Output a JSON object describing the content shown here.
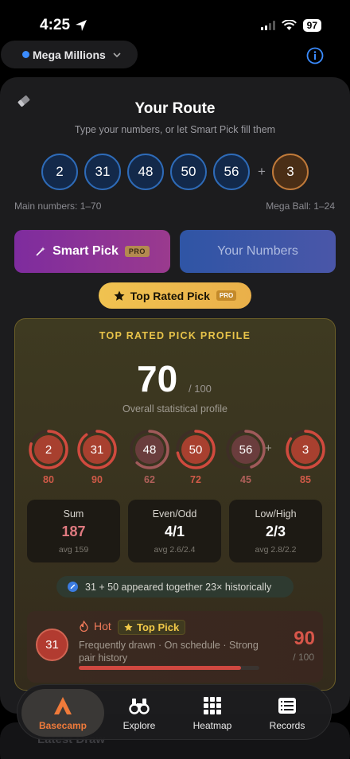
{
  "status": {
    "time": "4:25",
    "battery": "97"
  },
  "header": {
    "game_selector": "Mega Millions"
  },
  "route": {
    "title": "Your Route",
    "subtitle": "Type your numbers, or let Smart Pick fill them",
    "main_numbers": [
      "2",
      "31",
      "48",
      "50",
      "56"
    ],
    "plus": "+",
    "mega_ball": "3",
    "main_range": "Main numbers: 1–70",
    "mega_range": "Mega Ball: 1–24"
  },
  "actions": {
    "smart_pick": "Smart Pick",
    "smart_pick_badge": "PRO",
    "your_numbers": "Your Numbers",
    "top_rated_pick": "Top Rated Pick",
    "top_rated_badge": "PRO"
  },
  "profile": {
    "heading": "TOP RATED PICK PROFILE",
    "score": "70",
    "score_of": "/ 100",
    "score_label": "Overall statistical profile",
    "rings": [
      {
        "number": "2",
        "score": "80",
        "fill": 0.8
      },
      {
        "number": "31",
        "score": "90",
        "fill": 0.9
      },
      {
        "number": "48",
        "score": "62",
        "fill": 0.62
      },
      {
        "number": "50",
        "score": "72",
        "fill": 0.72
      },
      {
        "number": "56",
        "score": "45",
        "fill": 0.45
      },
      {
        "number": "3",
        "score": "85",
        "fill": 0.85
      }
    ],
    "ring_plus": "+",
    "stats": [
      {
        "title": "Sum",
        "value": "187",
        "avg": "avg 159"
      },
      {
        "title": "Even/Odd",
        "value": "4/1",
        "avg": "avg 2.6/2.4"
      },
      {
        "title": "Low/High",
        "value": "2/3",
        "avg": "avg 2.8/2.2"
      }
    ],
    "pair_note": "31 + 50 appeared together 23× historically",
    "hot": {
      "number": "31",
      "label": "Hot",
      "tag": "Top Pick",
      "description": "Frequently drawn · On schedule · Strong pair history",
      "score": "90",
      "score_of": "/ 100",
      "progress": 0.9
    }
  },
  "latest_draw": "Latest Draw",
  "tabs": [
    {
      "label": "Basecamp",
      "icon": "basecamp-icon"
    },
    {
      "label": "Explore",
      "icon": "binoculars-icon"
    },
    {
      "label": "Heatmap",
      "icon": "grid-icon"
    },
    {
      "label": "Records",
      "icon": "records-icon"
    }
  ],
  "colors": {
    "accent": "#ef7a3a",
    "gold": "#e9c44a",
    "hot": "#d8564a",
    "blue": "#3b8cff"
  }
}
